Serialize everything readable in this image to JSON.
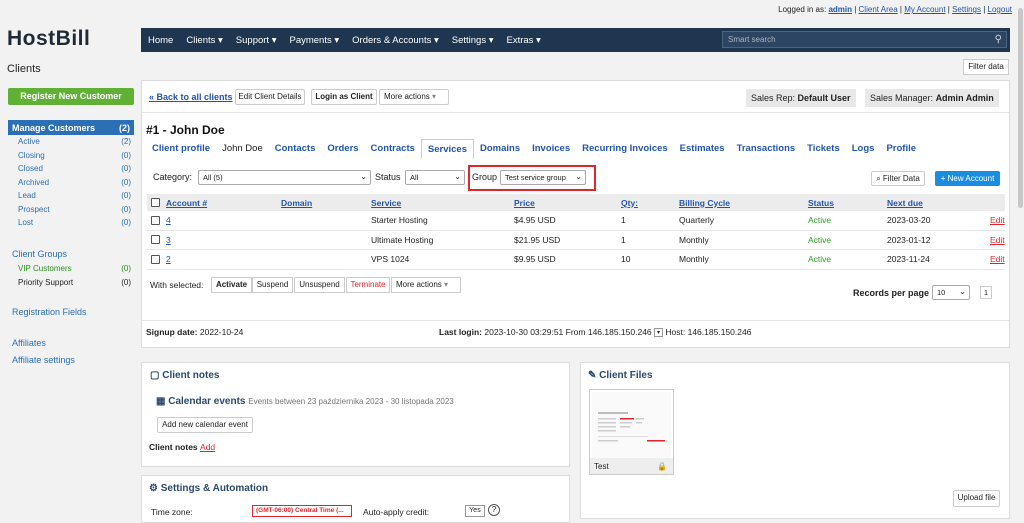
{
  "topbar": {
    "logged_in_as": "Logged in as:",
    "user": "admin",
    "links": [
      "Client Area",
      "My Account",
      "Settings",
      "Logout"
    ]
  },
  "logo": {
    "host": "Host",
    "bill": "Bill"
  },
  "sidebar": {
    "title": "Clients",
    "register_label": "Register New Customer",
    "manage_label": "Manage Customers",
    "manage_count": "(2)",
    "items": [
      {
        "label": "Active",
        "count": "(2)"
      },
      {
        "label": "Closing",
        "count": "(0)"
      },
      {
        "label": "Closed",
        "count": "(0)"
      },
      {
        "label": "Archived",
        "count": "(0)"
      },
      {
        "label": "Lead",
        "count": "(0)"
      },
      {
        "label": "Prospect",
        "count": "(0)"
      },
      {
        "label": "Lost",
        "count": "(0)"
      }
    ],
    "groups_label": "Client Groups",
    "vip": {
      "label": "VIP Customers",
      "count": "(0)"
    },
    "priority": {
      "label": "Priority Support",
      "count": "(0)"
    },
    "registration_fields": "Registration Fields",
    "affiliates": "Affiliates",
    "affiliate_settings": "Affiliate settings"
  },
  "nav": {
    "items": [
      "Home",
      "Clients ▾",
      "Support ▾",
      "Payments ▾",
      "Orders & Accounts ▾",
      "Settings ▾",
      "Extras ▾"
    ],
    "search_placeholder": "Smart search"
  },
  "filter_data_top": "Filter data",
  "client_bar": {
    "back": "« Back to all clients",
    "edit": "Edit Client Details",
    "login": "Login as Client",
    "more": "More actions",
    "sales_rep_label": "Sales Rep:",
    "sales_rep": "Default User",
    "sales_mgr_label": "Sales Manager:",
    "sales_mgr": "Admin Admin"
  },
  "client_title": "#1 - John Doe",
  "tabs": [
    "Client profile",
    "John Doe",
    "Contacts",
    "Orders",
    "Contracts",
    "Services",
    "Domains",
    "Invoices",
    "Recurring Invoices",
    "Estimates",
    "Transactions",
    "Tickets",
    "Logs",
    "Profile"
  ],
  "filters": {
    "category_label": "Category:",
    "category_value": "All (5)",
    "status_label": "Status",
    "status_value": "All",
    "group_label": "Group",
    "group_value": "Test service group",
    "filter_data": "Filter Data",
    "new_account": "New Account"
  },
  "table": {
    "headers": [
      "Account #",
      "Domain",
      "Service",
      "Price",
      "Qty:",
      "Billing Cycle",
      "Status",
      "Next due"
    ],
    "rows": [
      {
        "account": "4",
        "domain": "",
        "service": "Starter Hosting",
        "price": "$4.95 USD",
        "qty": "1",
        "cycle": "Quarterly",
        "status": "Active",
        "next_due": "2023-03-20",
        "edit": "Edit"
      },
      {
        "account": "3",
        "domain": "",
        "service": "Ultimate Hosting",
        "price": "$21.95 USD",
        "qty": "1",
        "cycle": "Monthly",
        "status": "Active",
        "next_due": "2023-01-12",
        "edit": "Edit"
      },
      {
        "account": "2",
        "domain": "",
        "service": "VPS 1024",
        "price": "$9.95 USD",
        "qty": "10",
        "cycle": "Monthly",
        "status": "Active",
        "next_due": "2023-11-24",
        "edit": "Edit"
      }
    ]
  },
  "bulk": {
    "label": "With selected:",
    "activate": "Activate",
    "suspend": "Suspend",
    "unsuspend": "Unsuspend",
    "terminate": "Terminate",
    "more": "More actions",
    "records_label": "Records per page",
    "records_value": "10",
    "page": "1"
  },
  "signup": {
    "label": "Signup date:",
    "value": "2022-10-24"
  },
  "lastlogin": {
    "label": "Last login:",
    "value": "2023-10-30 03:29:51 From 146.185.150.246",
    "host": "Host: 146.185.150.246"
  },
  "notes": {
    "title": "Client notes",
    "cal_title": "Calendar events",
    "cal_sub": "Events between 23 października 2023 - 30 listopada 2023",
    "add_cal": "Add new calendar event",
    "client_notes": "Client notes",
    "add": "Add"
  },
  "files": {
    "title": "Client Files",
    "file_name": "Test",
    "upload": "Upload file"
  },
  "settings": {
    "title": "Settings & Automation",
    "tz_label": "Time zone:",
    "tz_value": "(GMT-06:00) Central Time (...",
    "aa_label": "Auto-apply credit:",
    "aa_value": "Yes"
  },
  "colors": {
    "nav": "#1f3651",
    "accent": "#2b6fb4",
    "green": "#5fb034",
    "red": "#e0262a",
    "new_account": "#1a8de0"
  }
}
